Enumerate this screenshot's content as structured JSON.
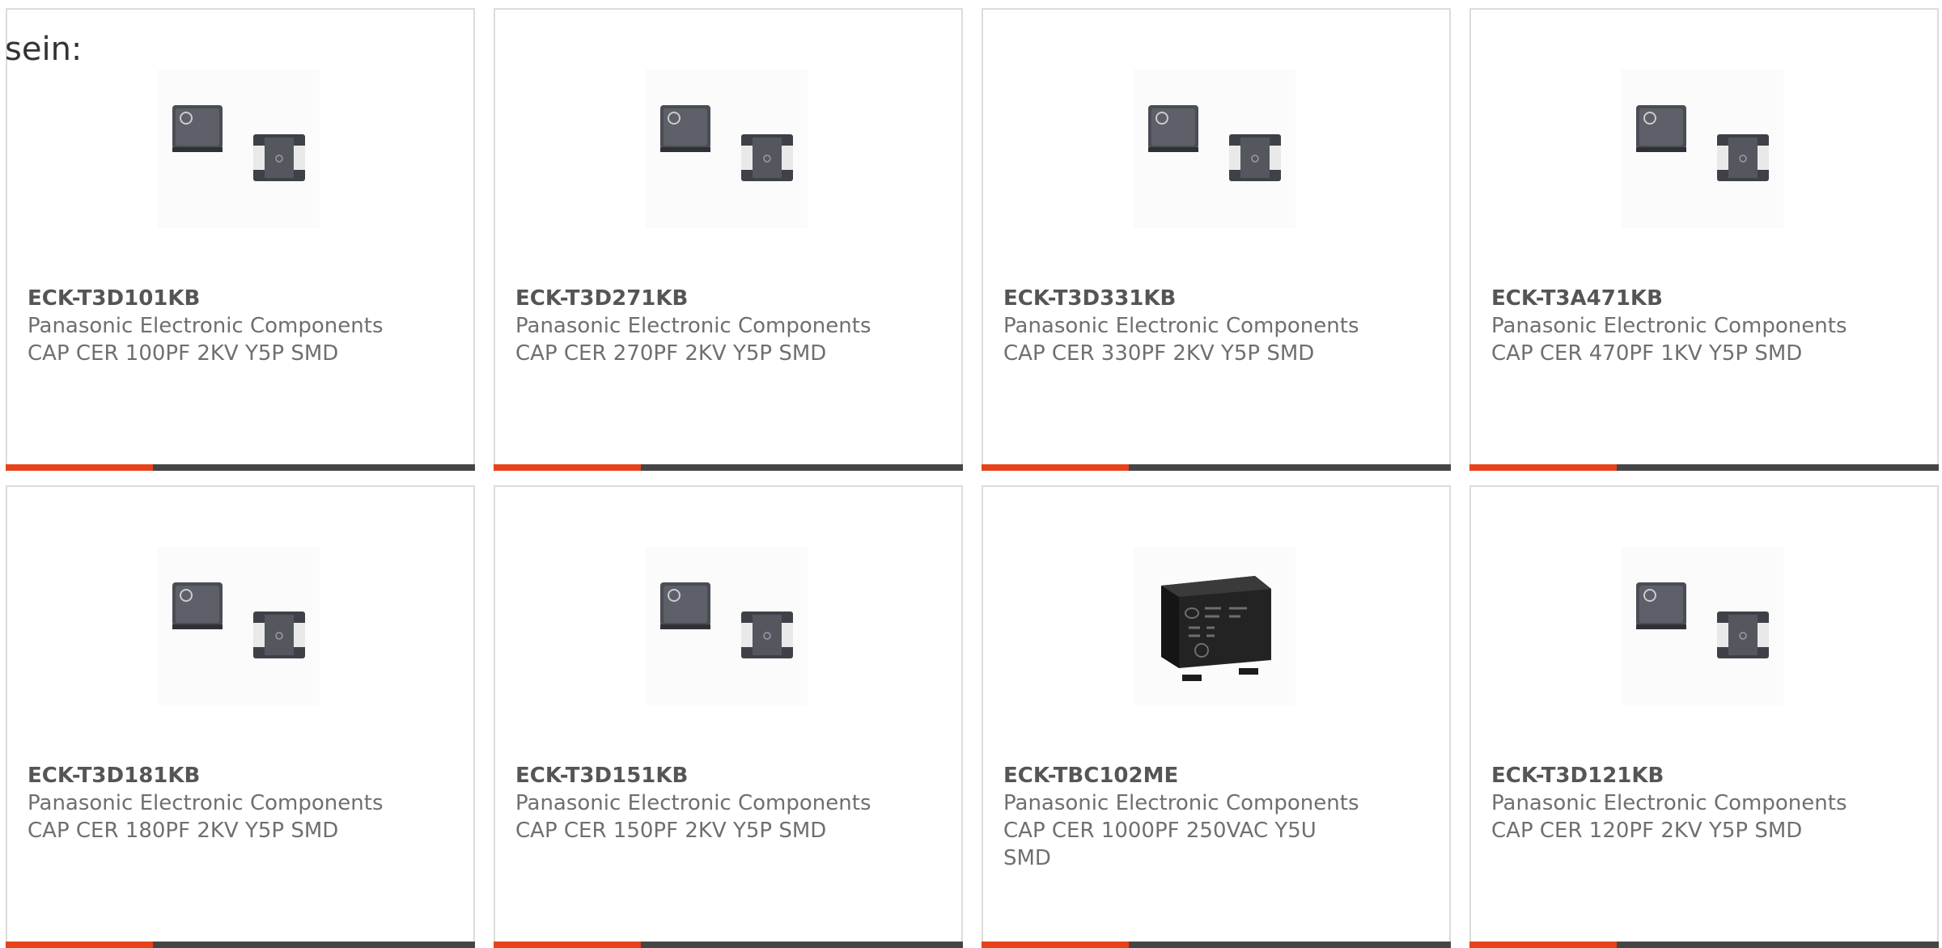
{
  "intro_text": "sein:",
  "accent_color": "#e8421a",
  "bar_color": "#454545",
  "products": [
    {
      "part_number": "ECK-T3D101KB",
      "manufacturer": "Panasonic Electronic Components",
      "description": "CAP CER 100PF 2KV Y5P SMD",
      "image": "two-smd-capacitors"
    },
    {
      "part_number": "ECK-T3D271KB",
      "manufacturer": "Panasonic Electronic Components",
      "description": "CAP CER 270PF 2KV Y5P SMD",
      "image": "two-smd-capacitors"
    },
    {
      "part_number": "ECK-T3D331KB",
      "manufacturer": "Panasonic Electronic Components",
      "description": "CAP CER 330PF 2KV Y5P SMD",
      "image": "two-smd-capacitors"
    },
    {
      "part_number": "ECK-T3A471KB",
      "manufacturer": "Panasonic Electronic Components",
      "description": "CAP CER 470PF 1KV Y5P SMD",
      "image": "two-smd-capacitors"
    },
    {
      "part_number": "ECK-T3D181KB",
      "manufacturer": "Panasonic Electronic Components",
      "description": "CAP CER 180PF 2KV Y5P SMD",
      "image": "two-smd-capacitors"
    },
    {
      "part_number": "ECK-T3D151KB",
      "manufacturer": "Panasonic Electronic Components",
      "description": "CAP CER 150PF 2KV Y5P SMD",
      "image": "two-smd-capacitors"
    },
    {
      "part_number": "ECK-TBC102ME",
      "manufacturer": "Panasonic Electronic Components",
      "description": "CAP CER 1000PF 250VAC Y5U SMD",
      "image": "black-smd-capacitor"
    },
    {
      "part_number": "ECK-T3D121KB",
      "manufacturer": "Panasonic Electronic Components",
      "description": "CAP CER 120PF 2KV Y5P SMD",
      "image": "two-smd-capacitors"
    }
  ]
}
